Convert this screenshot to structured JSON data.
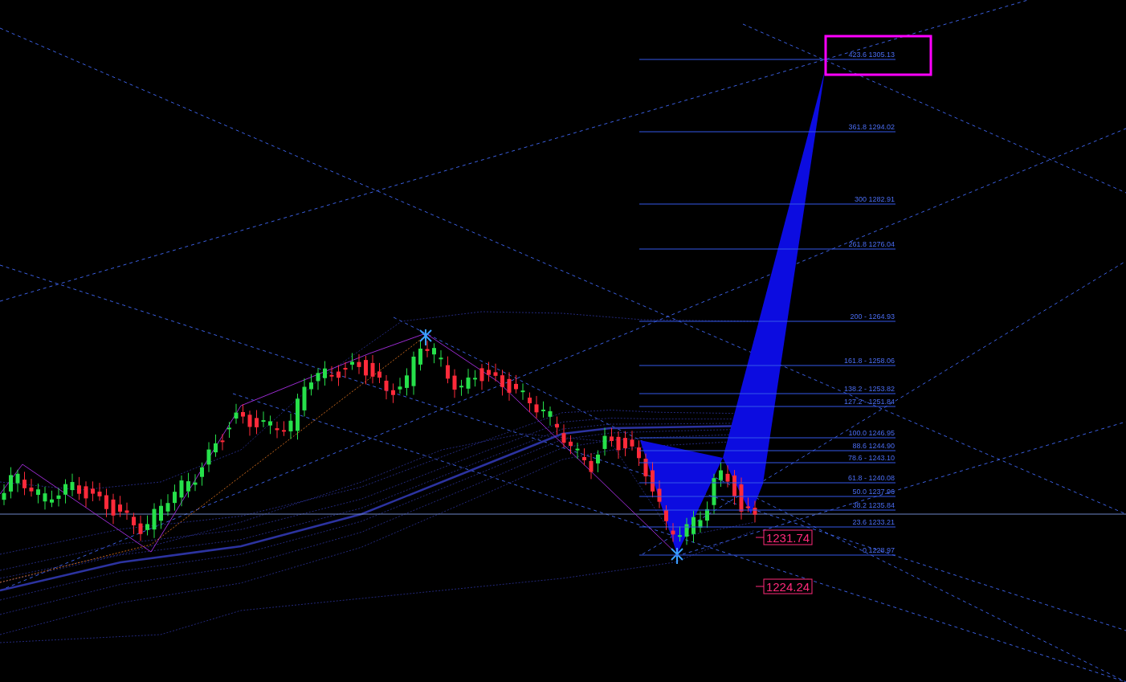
{
  "fib_levels": [
    {
      "label": "423.6 1305.13"
    },
    {
      "label": "361.8 1294.02"
    },
    {
      "label": "300 1282.91"
    },
    {
      "label": "261.8 1276.04"
    },
    {
      "label": "200 - 1264.93"
    },
    {
      "label": "161.8 -  1258.06"
    },
    {
      "label": "138.2 - 1253.82"
    },
    {
      "label": "127.2 - 1251.84"
    },
    {
      "label": "100.0 1246.95"
    },
    {
      "label": "88.6 1244.90"
    },
    {
      "label": "78.6 - 1243.10"
    },
    {
      "label": "61.8 - 1240.08"
    },
    {
      "label": "50.0 1237.96"
    },
    {
      "label": "38.2 1235.84"
    },
    {
      "label": "23.6 1233.21"
    },
    {
      "label": "0 1228.97"
    }
  ],
  "price_labels": [
    {
      "value": "1231.74"
    },
    {
      "value": "1224.24"
    }
  ]
}
